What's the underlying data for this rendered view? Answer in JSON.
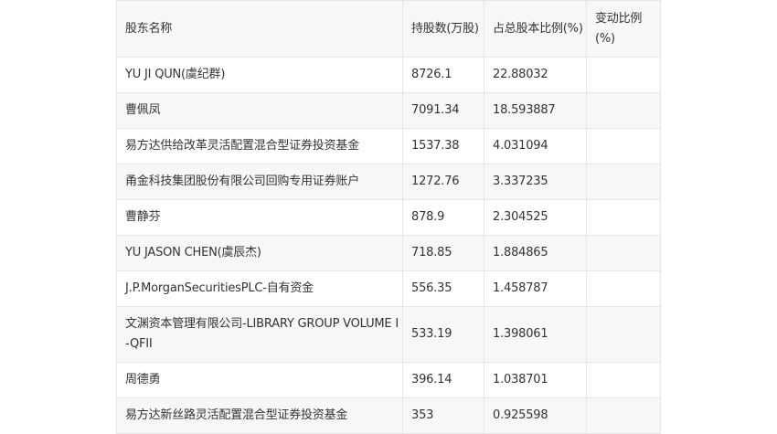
{
  "table": {
    "headers": [
      "股东名称",
      "持股数(万股)",
      "占总股本比例(%)",
      "变动比例(%)"
    ],
    "rows": [
      {
        "name": "YU JI QUN(虞纪群)",
        "shares": "8726.1",
        "ratio": "22.88032",
        "change": ""
      },
      {
        "name": "曹佩凤",
        "shares": "7091.34",
        "ratio": "18.593887",
        "change": ""
      },
      {
        "name": "易方达供给改革灵活配置混合型证券投资基金",
        "shares": "1537.38",
        "ratio": "4.031094",
        "change": ""
      },
      {
        "name": "甬金科技集团股份有限公司回购专用证券账户",
        "shares": "1272.76",
        "ratio": "3.337235",
        "change": ""
      },
      {
        "name": "曹静芬",
        "shares": "878.9",
        "ratio": "2.304525",
        "change": ""
      },
      {
        "name": "YU JASON CHEN(虞辰杰)",
        "shares": "718.85",
        "ratio": "1.884865",
        "change": ""
      },
      {
        "name": "J.P.MorganSecuritiesPLC-自有资金",
        "shares": "556.35",
        "ratio": "1.458787",
        "change": ""
      },
      {
        "name": "文渊资本管理有限公司-LIBRARY GROUP VOLUME I-QFII",
        "shares": "533.19",
        "ratio": "1.398061",
        "change": ""
      },
      {
        "name": "周德勇",
        "shares": "396.14",
        "ratio": "1.038701",
        "change": ""
      },
      {
        "name": "易方达新丝路灵活配置混合型证券投资基金",
        "shares": "353",
        "ratio": "0.925598",
        "change": ""
      }
    ]
  }
}
